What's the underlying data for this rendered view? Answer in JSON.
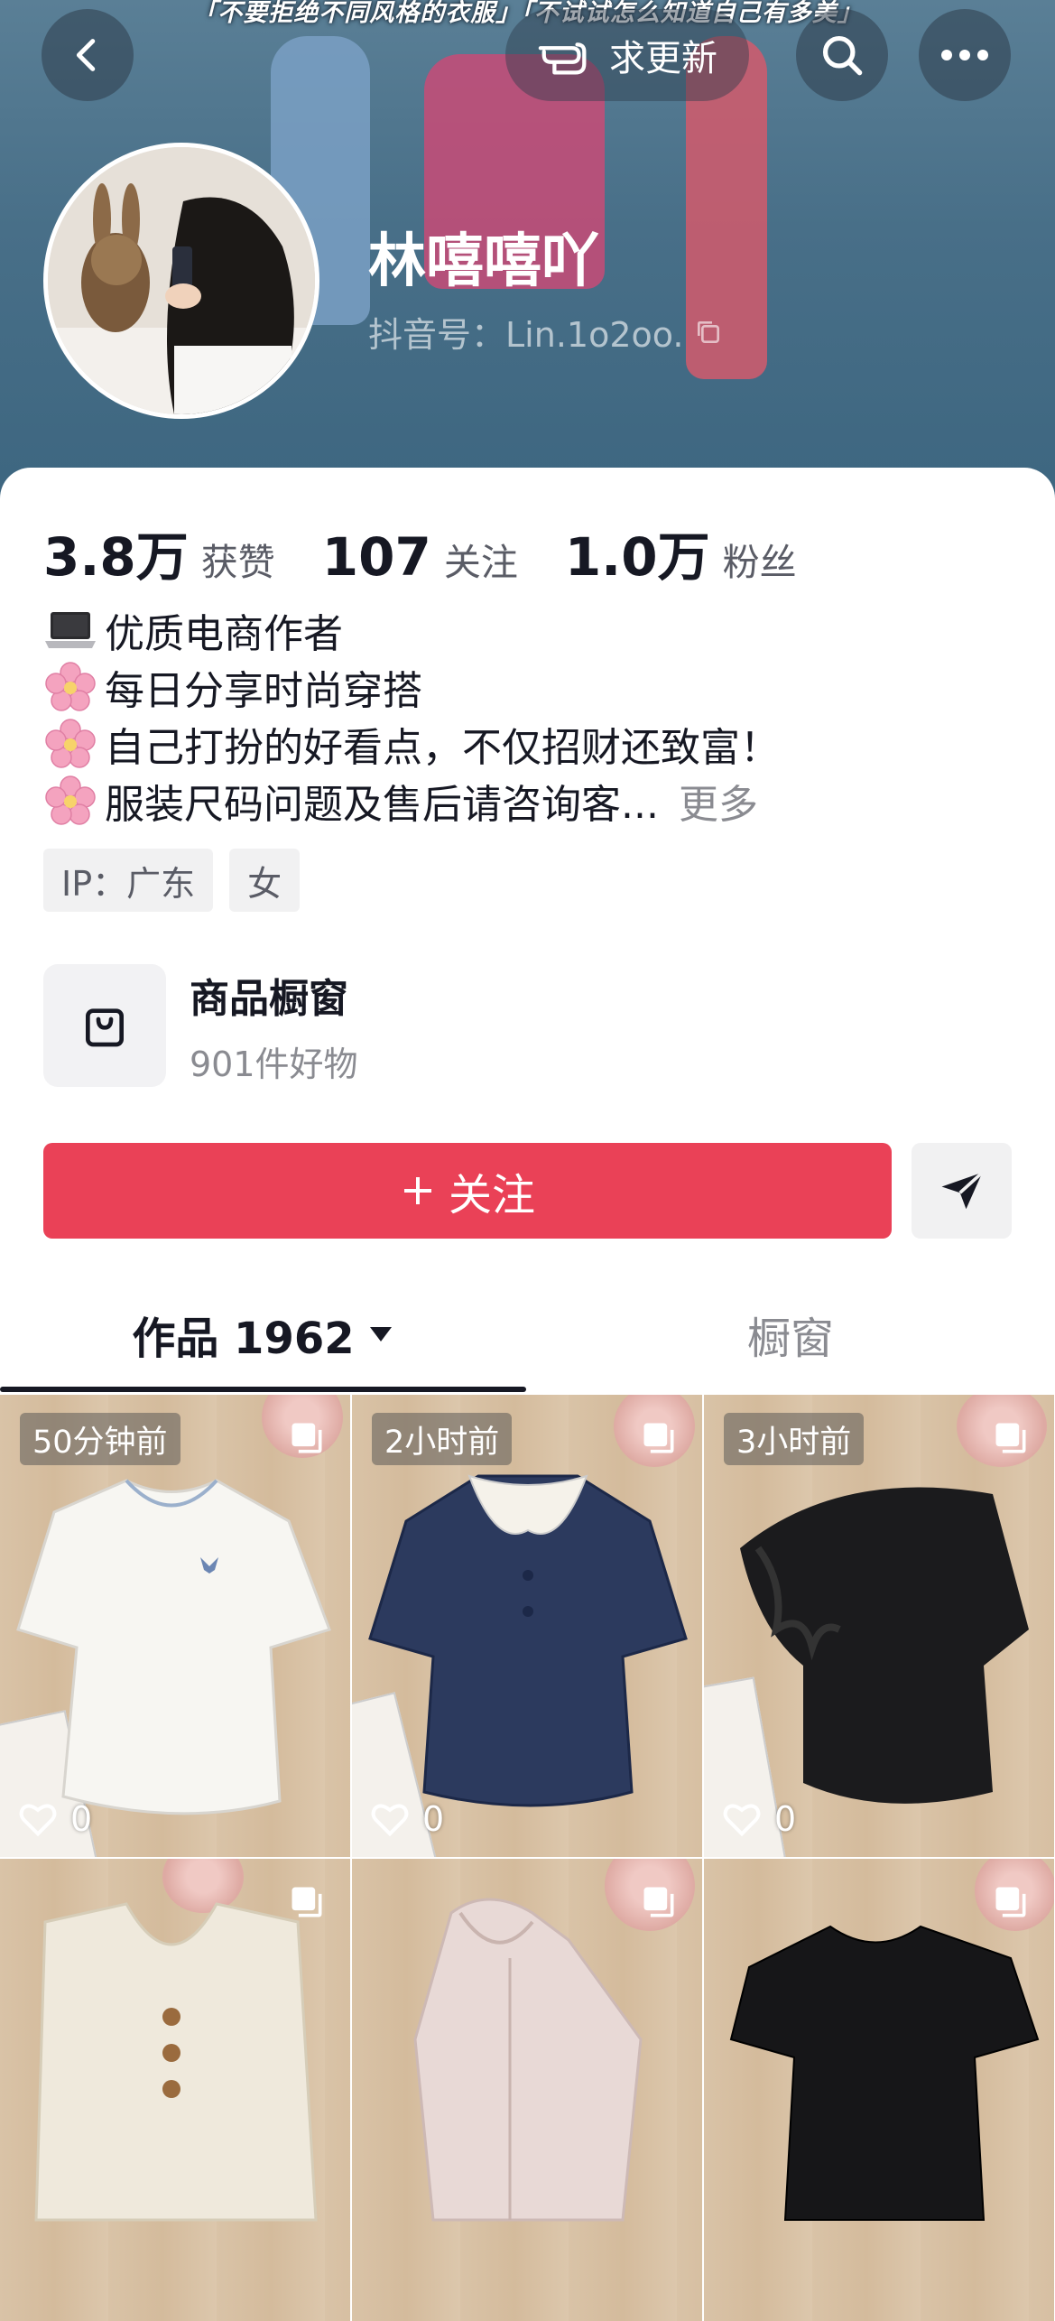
{
  "banner": {
    "caption": "「不要拒绝不同风格的衣服」「不试试怎么知道自己有多美」",
    "update_button_label": "求更新"
  },
  "profile": {
    "name": "林嘻嘻吖",
    "douyin_id": "抖音号：Lin.1o2oo."
  },
  "stats": [
    {
      "value": "3.8万",
      "label": "获赞"
    },
    {
      "value": "107",
      "label": "关注"
    },
    {
      "value": "1.0万",
      "label": "粉丝"
    }
  ],
  "bio": {
    "lines": [
      {
        "icon": "laptop-emoji",
        "text": "优质电商作者"
      },
      {
        "icon": "cherry-blossom-emoji",
        "text": "每日分享时尚穿搭"
      },
      {
        "icon": "cherry-blossom-emoji",
        "text": "自己打扮的好看点，不仅招财还致富！"
      },
      {
        "icon": "cherry-blossom-emoji",
        "text": "服装尺码问题及售后请咨询客..."
      }
    ],
    "more_label": "更多"
  },
  "tags": [
    "IP：广东",
    "女"
  ],
  "shop": {
    "title": "商品橱窗",
    "subtitle": "901件好物"
  },
  "actions": {
    "follow_label": "关注"
  },
  "tabs": {
    "works_label": "作品 1962",
    "showcase_label": "橱窗"
  },
  "posts": [
    {
      "time": "50分钟前",
      "likes": "0",
      "item": "white-tshirt"
    },
    {
      "time": "2小时前",
      "likes": "0",
      "item": "navy-collar-top"
    },
    {
      "time": "3小时前",
      "likes": "0",
      "item": "black-ruffle-top"
    },
    {
      "time": "",
      "likes": "",
      "item": "cream-vest"
    },
    {
      "time": "",
      "likes": "",
      "item": "pink-hoodie"
    },
    {
      "time": "",
      "likes": "",
      "item": "black-tshirt"
    }
  ],
  "colors": {
    "accent": "#ea4157",
    "banner": "#4a718a"
  }
}
